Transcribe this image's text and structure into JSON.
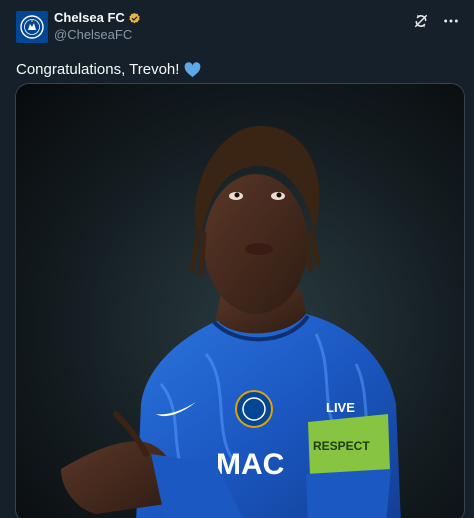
{
  "account": {
    "display_name": "Chelsea FC",
    "handle": "@ChelseaFC",
    "verified": true,
    "verified_color": "#e7b43d",
    "avatar_bg": "#034694"
  },
  "tweet": {
    "text": "Congratulations, Trevoh!",
    "emoji_icon": "blue-heart-icon",
    "emoji_color": "#5da8e8"
  },
  "media": {
    "kit_sponsor": "MAC",
    "sleeve_patch": "LIVE",
    "armband_text": "RESPECT",
    "kit_color": "#1b58c2",
    "armband_color": "#86c442"
  },
  "icons": {
    "refresh": "refresh-icon",
    "more": "more-icon",
    "verified": "verified-badge-icon"
  }
}
